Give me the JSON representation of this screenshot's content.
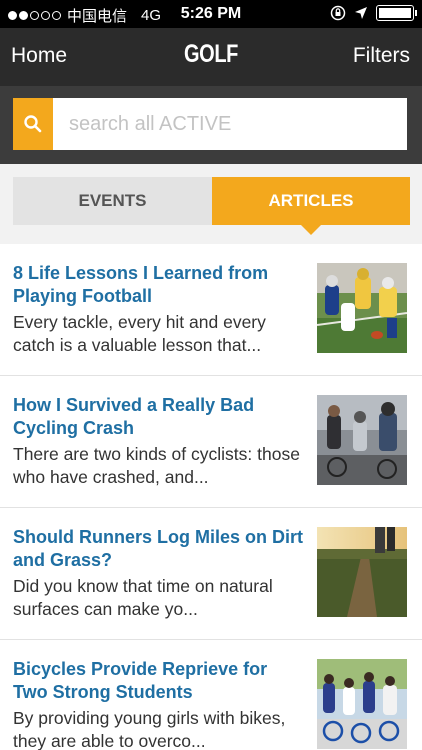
{
  "status_bar": {
    "carrier": "中国电信",
    "network": "4G",
    "time": "5:26 PM"
  },
  "nav": {
    "home_label": "Home",
    "title": "GOLF",
    "filters_label": "Filters"
  },
  "search": {
    "placeholder": "search all ACTIVE"
  },
  "tabs": [
    {
      "label": "EVENTS",
      "selected": false
    },
    {
      "label": "ARTICLES",
      "selected": true
    }
  ],
  "articles": [
    {
      "title": "8 Life Lessons I Learned from Playing Football",
      "excerpt": "Every tackle, every hit and every catch is a valuable lesson that...",
      "thumbnail": "football-players-image"
    },
    {
      "title": "How I Survived a Really Bad Cycling Crash",
      "excerpt": "There are two kinds of cyclists: those who have crashed, and...",
      "thumbnail": "cyclists-image"
    },
    {
      "title": "Should Runners Log Miles on Dirt and Grass?",
      "excerpt": "Did you know that time on natural surfaces can make yo...",
      "thumbnail": "dirt-trail-runner-image"
    },
    {
      "title": "Bicycles Provide Reprieve for Two Strong Students",
      "excerpt": "By providing young girls with bikes, they are able to overco...",
      "thumbnail": "students-bicycles-image"
    }
  ],
  "colors": {
    "accent": "#f3a81d",
    "nav_bg": "#2b2b2b",
    "search_bg": "#3c3c3c",
    "link_title": "#1f6fa3"
  }
}
